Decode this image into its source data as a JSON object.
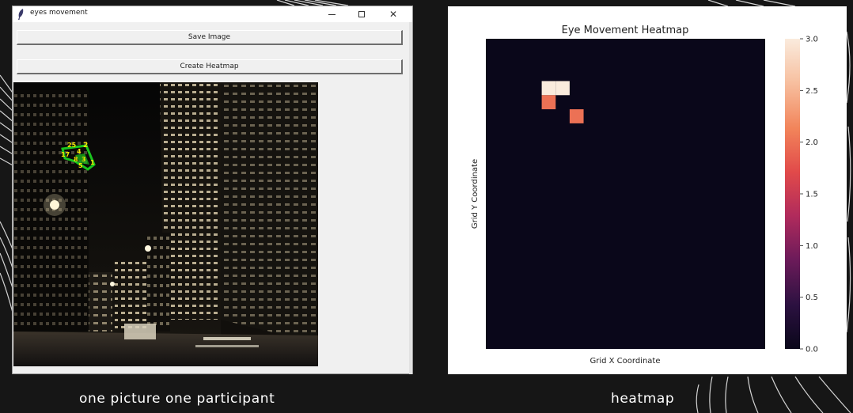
{
  "window": {
    "title": "eyes movement",
    "icon": "feather-icon",
    "controls": {
      "minimize": "minimize-icon",
      "maximize": "maximize-icon",
      "close": "✕"
    }
  },
  "buttons": {
    "save_label": "Save Image",
    "heatmap_label": "Create Heatmap"
  },
  "gaze_overlay": {
    "labels": [
      "2",
      "25",
      "4",
      "17",
      "8",
      "3",
      "5",
      "1"
    ],
    "colors": {
      "label": "#f2e600",
      "marker": "#19c41e"
    }
  },
  "captions": {
    "left": "one picture one participant",
    "right": "heatmap"
  },
  "chart_data": {
    "type": "heatmap",
    "title": "Eye Movement Heatmap",
    "xlabel": "Grid X Coordinate",
    "ylabel": "Grid Y Coordinate",
    "grid_size": [
      20,
      22
    ],
    "background_value": 0,
    "cells": [
      {
        "x": 4,
        "y": 3,
        "value": 3
      },
      {
        "x": 5,
        "y": 3,
        "value": 3
      },
      {
        "x": 4,
        "y": 4,
        "value": 2
      },
      {
        "x": 6,
        "y": 5,
        "value": 2
      }
    ],
    "colorbar": {
      "range": [
        0.0,
        3.0
      ],
      "ticks": [
        "0.0",
        "0.5",
        "1.0",
        "1.5",
        "2.0",
        "2.5",
        "3.0"
      ],
      "colormap": [
        "#0a071a",
        "#2b1140",
        "#6d1b5a",
        "#b12b5c",
        "#e14a4a",
        "#f2845a",
        "#f7c0a0",
        "#faebdd"
      ]
    }
  }
}
